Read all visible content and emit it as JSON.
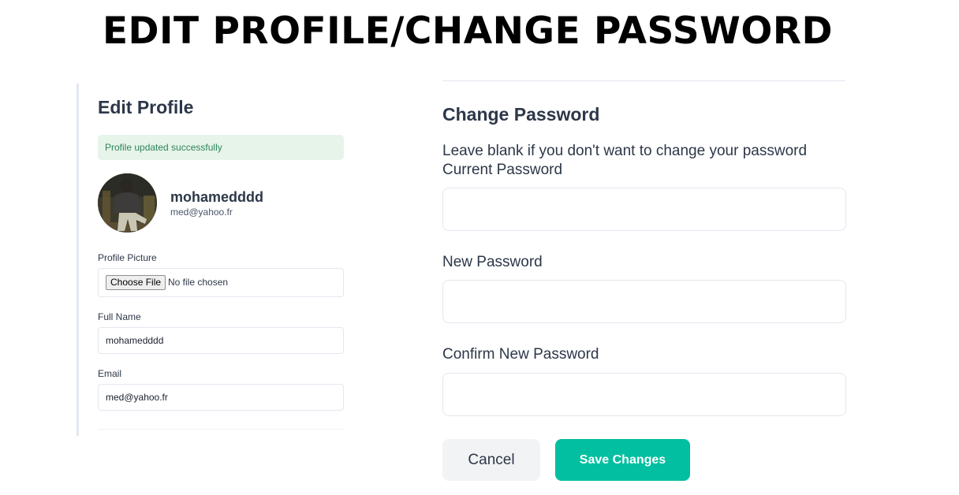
{
  "banner": {
    "title": "EDIT PROFILE/CHANGE PASSWORD"
  },
  "edit_profile": {
    "title": "Edit Profile",
    "alert": "Profile updated successfully",
    "user": {
      "name": "mohamedddd",
      "email": "med@yahoo.fr"
    },
    "fields": {
      "profile_picture": {
        "label": "Profile Picture",
        "button_label": "Choose File",
        "status": "No file chosen"
      },
      "full_name": {
        "label": "Full Name",
        "value": "mohamedddd"
      },
      "email": {
        "label": "Email",
        "value": "med@yahoo.fr"
      }
    }
  },
  "change_password": {
    "title": "Change Password",
    "hint": "Leave blank if you don't want to change your password",
    "fields": {
      "current": {
        "label": "Current Password",
        "value": ""
      },
      "new": {
        "label": "New Password",
        "value": ""
      },
      "confirm": {
        "label": "Confirm New Password",
        "value": ""
      }
    }
  },
  "actions": {
    "cancel_label": "Cancel",
    "save_label": "Save Changes"
  },
  "colors": {
    "accent": "#01bfa0",
    "alert_bg": "#e6f4ea",
    "alert_text": "#2f855a",
    "heading": "#2d3748"
  }
}
